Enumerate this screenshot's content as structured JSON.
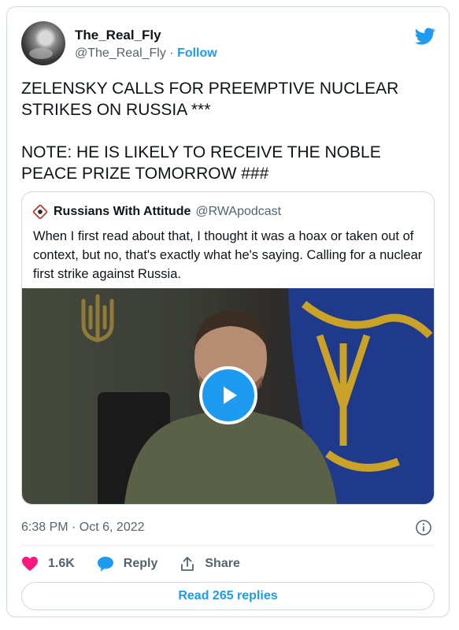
{
  "author": {
    "display_name": "The_Real_Fly",
    "handle": "@The_Real_Fly",
    "separator": " · ",
    "follow_label": "Follow",
    "avatar_icon": "avatar-photo"
  },
  "tweet": {
    "text": "ZELENSKY CALLS FOR PREEMPTIVE NUCLEAR STRIKES ON RUSSIA ***\n\nNOTE: HE IS LIKELY TO RECEIVE THE NOBLE PEACE PRIZE TOMORROW ###"
  },
  "quoted": {
    "display_name": "Russians With Attitude",
    "handle": "@RWApodcast",
    "text": "When I first read about that, I thought it was a hoax or taken out of context, but no, that's exactly what he's saying. Calling for a nuclear first strike against Russia.",
    "media": {
      "type": "video",
      "play_icon": "play-icon"
    }
  },
  "meta": {
    "timestamp": "6:38 PM · Oct 6, 2022",
    "info_icon": "info-icon"
  },
  "actions": {
    "likes_count": "1.6K",
    "reply_label": "Reply",
    "share_label": "Share",
    "read_replies_label": "Read 265 replies"
  },
  "colors": {
    "accent": "#1d9bf0",
    "like": "#f91880",
    "text": "#0f1419",
    "secondary": "#536471",
    "border": "#cfd9de"
  }
}
